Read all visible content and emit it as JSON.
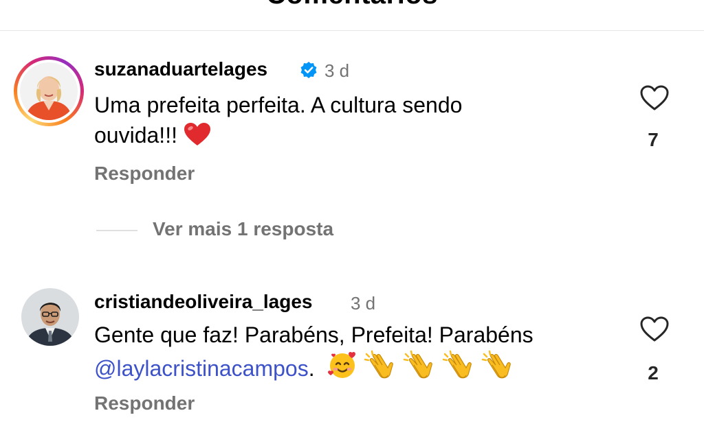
{
  "header": {
    "title": "Comentários"
  },
  "comments": [
    {
      "username": "suzanaduartelages",
      "verified": true,
      "time": "3 d",
      "text_line1": "Uma prefeita perfeita. A cultura sendo",
      "text_line2": "ouvida!!!",
      "emoji": "red-heart",
      "reply_label": "Responder",
      "likes": "7",
      "has_story_ring": true
    },
    {
      "username": "cristiandeoliveira_lages",
      "verified": false,
      "time": "3 d",
      "text_line1": "Gente que faz! Parabéns, Prefeita! Parabéns",
      "mention": "@laylacristinacampos",
      "text_after_mention": ".",
      "emojis": [
        "smiling-face-with-hearts",
        "clapping-hands",
        "clapping-hands",
        "clapping-hands",
        "clapping-hands"
      ],
      "reply_label": "Responder",
      "likes": "2",
      "has_story_ring": false
    }
  ],
  "view_more": {
    "label": "Ver mais 1 resposta"
  },
  "colors": {
    "secondary_text": "#737373",
    "mention": "#3d52c8",
    "verified_badge": "#0095f6",
    "divider": "#e6e6e6"
  }
}
